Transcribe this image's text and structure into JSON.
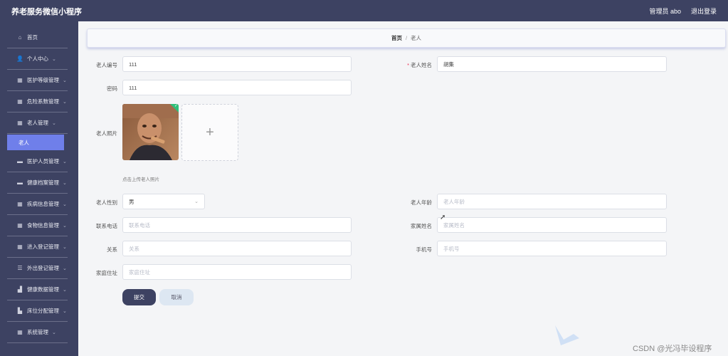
{
  "header": {
    "title": "养老服务微信小程序",
    "user_label": "管理员 abo",
    "logout_label": "退出登录"
  },
  "sidebar": {
    "items": [
      {
        "label": "首页",
        "icon": "home-icon",
        "chevron": false
      },
      {
        "label": "个人中心",
        "icon": "user-icon",
        "chevron": true
      },
      {
        "label": "医护等级管理",
        "icon": "grid-icon",
        "chevron": true
      },
      {
        "label": "危险系数管理",
        "icon": "grid-icon",
        "chevron": true
      },
      {
        "label": "老人管理",
        "icon": "grid-icon",
        "chevron": true
      },
      {
        "label": "医护人员管理",
        "icon": "card-icon",
        "chevron": true
      },
      {
        "label": "健康档案管理",
        "icon": "card-icon",
        "chevron": true
      },
      {
        "label": "疾病信息管理",
        "icon": "grid-icon",
        "chevron": true
      },
      {
        "label": "食物信息管理",
        "icon": "grid-icon",
        "chevron": true
      },
      {
        "label": "进入登记管理",
        "icon": "grid-icon",
        "chevron": true
      },
      {
        "label": "外出登记管理",
        "icon": "list-icon",
        "chevron": true
      },
      {
        "label": "健康数据管理",
        "icon": "bank-icon",
        "chevron": true
      },
      {
        "label": "床位分配管理",
        "icon": "bed-icon",
        "chevron": true
      },
      {
        "label": "系统管理",
        "icon": "grid-icon",
        "chevron": true
      }
    ],
    "active_sub": "老人"
  },
  "breadcrumb": {
    "home": "首页",
    "separator": "/",
    "current": "老人"
  },
  "form": {
    "elder_no_label": "老人编号",
    "elder_no_value": "111",
    "elder_name_label": "老人姓名",
    "elder_name_value": "胡集",
    "password_label": "密码",
    "password_value": "111",
    "photo_label": "老人照片",
    "upload_hint": "点击上传老人照片",
    "gender_label": "老人性别",
    "gender_value": "男",
    "age_label": "老人年龄",
    "age_placeholder": "老人年龄",
    "phone_label": "联系电话",
    "phone_placeholder": "联系电话",
    "family_name_label": "家属姓名",
    "family_name_placeholder": "家属姓名",
    "relation_label": "关系",
    "relation_placeholder": "关系",
    "mobile_label": "手机号",
    "mobile_placeholder": "手机号",
    "address_label": "家庭住址",
    "address_placeholder": "家庭住址",
    "submit_label": "提交",
    "cancel_label": "取消"
  },
  "watermark": "CSDN @光冯毕设程序",
  "colors": {
    "nav_bg": "#3d4262",
    "active_sub": "#6f7fea",
    "submit_btn": "#3d4262",
    "cancel_btn": "#dde7f2"
  }
}
